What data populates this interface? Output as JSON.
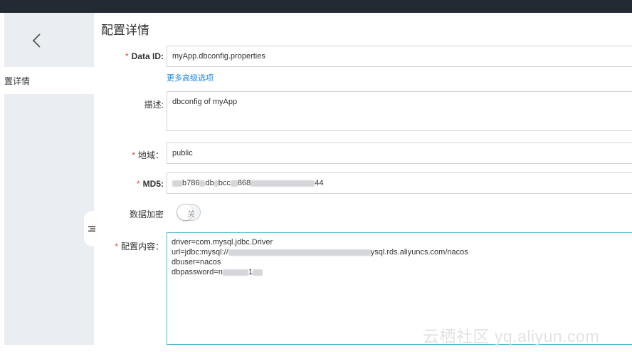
{
  "sidebar": {
    "back_icon": "chevron-left-icon",
    "active_item_label": "置详情",
    "collapse_icon": "menu-collapse-icon"
  },
  "page": {
    "title": "配置详情"
  },
  "form": {
    "data_id": {
      "label": "Data ID:",
      "value": "myApp.dbconfig.properties",
      "required": true
    },
    "more_options_link": "更多高级选项",
    "description": {
      "label": "描述:",
      "value": "dbconfig of myApp"
    },
    "region": {
      "label": "地域：",
      "value": "public",
      "required": true
    },
    "md5": {
      "label": "MD5:",
      "value_start": "b786",
      "value_mid1": "db",
      "value_mid2": "bcc",
      "value_mid3": "868",
      "value_end": "44",
      "required": true
    },
    "encryption": {
      "label": "数据加密",
      "toggle_label": "关",
      "enabled": false
    },
    "content": {
      "label": "配置内容：",
      "required": true,
      "lines": {
        "line1": "driver=com.mysql.jdbc.Driver",
        "line2_start": "url=jdbc:mysql://",
        "line2_end": "ysql.rds.aliyuncs.com/nacos",
        "line3": "dbuser=nacos",
        "line4_start": "dbpassword=n",
        "line4_end": "1"
      }
    }
  },
  "watermark": "云栖社区 yq.aliyun.com",
  "colors": {
    "top_bar": "#242a33",
    "sidebar": "#eaedf1",
    "required": "#e5473b",
    "link": "#1a88e8",
    "focus_border": "#4fb8d4"
  }
}
